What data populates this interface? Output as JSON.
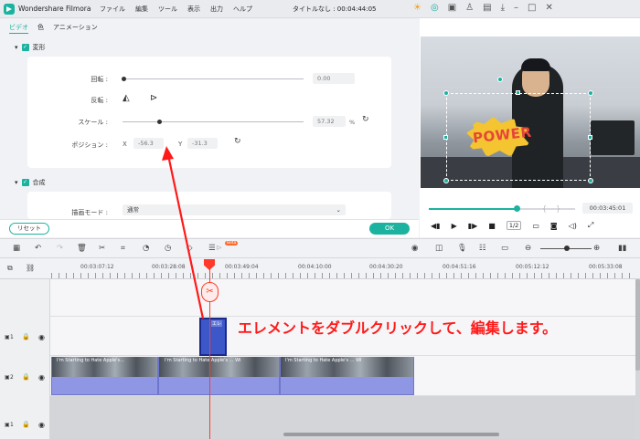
{
  "titlebar": {
    "app_name": "Wondershare Filmora",
    "menu": [
      "ファイル",
      "編集",
      "ツール",
      "表示",
      "出力",
      "ヘルプ"
    ],
    "doc_title": "タイトルなし : 00:04:44:05",
    "icons": [
      "bulb-icon",
      "headset-icon",
      "gift-icon",
      "user-icon",
      "save-icon",
      "download-icon",
      "minimize-icon",
      "maximize-icon",
      "close-icon"
    ]
  },
  "tabs": [
    "ビデオ",
    "色",
    "アニメーション"
  ],
  "transform": {
    "section_label": "変形",
    "rotate_label": "回転 :",
    "rotate_value": "0.00",
    "flip_label": "反転 :",
    "scale_label": "スケール :",
    "scale_value": "57.32",
    "scale_unit": "%",
    "scale_fraction": 0.2,
    "position_label": "ポジション :",
    "x_label": "X",
    "x_value": "-56.3",
    "y_label": "Y",
    "y_value": "-31.3"
  },
  "composite": {
    "section_label": "合成",
    "blend_label": "描画モード :",
    "blend_value": "通常"
  },
  "buttons": {
    "reset": "リセット",
    "ok": "OK"
  },
  "preview": {
    "overlay_text": "POWER",
    "timecode": "00:03:45:01",
    "speed": "1/2",
    "progress_fraction": 0.6
  },
  "timeline": {
    "beta_badge": "Beta",
    "ruler_labels": [
      "00:03:07:12",
      "00:03:28:08",
      "00:03:49:04",
      "00:04:10:00",
      "00:04:30:20",
      "00:04:51:16",
      "00:05:12:12",
      "00:05:33:08"
    ],
    "element_clip_label": "エレ",
    "video_clip_titles": [
      "I'm Starting to Hate Apple's...",
      "I'm Starting to Hate Apple's ... Wi",
      "I'm Starting to Hate Apple's ... Wi"
    ],
    "track_labels": [
      "1",
      "2",
      "1"
    ]
  },
  "annotation": "エレメントをダブルクリックして、編集します。",
  "colors": {
    "accent": "#1bb3a0",
    "annotation": "#ff1a1a",
    "playhead": "#ff3a2a",
    "element_clip": "#3b57c8",
    "video_clip": "#8f97e4"
  }
}
